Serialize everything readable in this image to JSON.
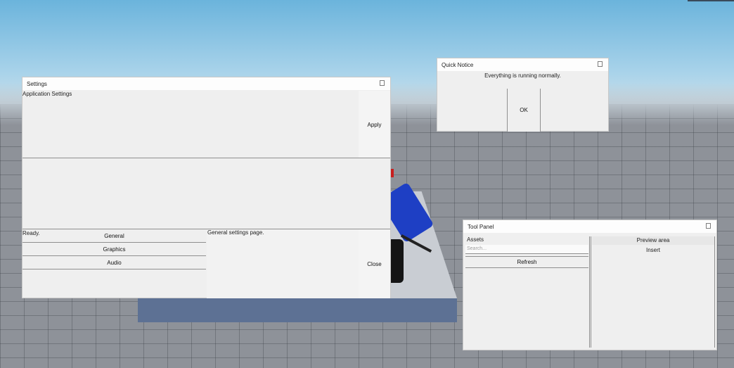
{
  "settings": {
    "title": "Settings",
    "app_settings_label": "Application Settings",
    "apply_label": "Apply",
    "status_text": "Ready.",
    "nav_items": [
      "General",
      "Graphics",
      "Audio"
    ],
    "page_text": "General settings page.",
    "close_label": "Close"
  },
  "notice": {
    "title": "Quick Notice",
    "message": "Everything is running normally.",
    "ok_label": "OK"
  },
  "tool_panel": {
    "title": "Tool Panel",
    "assets_label": "Assets",
    "search_placeholder": "Search...",
    "refresh_label": "Refresh",
    "preview_label": "Preview area",
    "insert_label": "Insert"
  },
  "colors": {
    "sky": "#6bb4dc",
    "ground": "#8e9299",
    "window_bg": "#efefef",
    "titlebar_bg": "#fdfdfd"
  }
}
